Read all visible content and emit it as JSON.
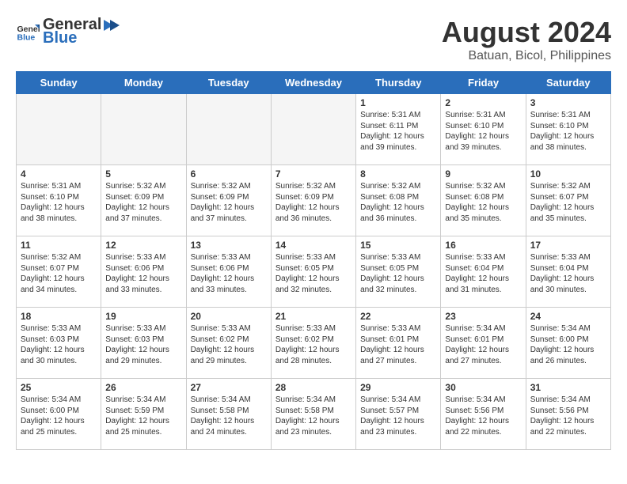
{
  "header": {
    "logo_general": "General",
    "logo_blue": "Blue",
    "month_year": "August 2024",
    "location": "Batuan, Bicol, Philippines"
  },
  "days_of_week": [
    "Sunday",
    "Monday",
    "Tuesday",
    "Wednesday",
    "Thursday",
    "Friday",
    "Saturday"
  ],
  "weeks": [
    [
      {
        "date": "",
        "text": "",
        "empty": true
      },
      {
        "date": "",
        "text": "",
        "empty": true
      },
      {
        "date": "",
        "text": "",
        "empty": true
      },
      {
        "date": "",
        "text": "",
        "empty": true
      },
      {
        "date": "1",
        "text": "Sunrise: 5:31 AM\nSunset: 6:11 PM\nDaylight: 12 hours\nand 39 minutes.",
        "empty": false
      },
      {
        "date": "2",
        "text": "Sunrise: 5:31 AM\nSunset: 6:10 PM\nDaylight: 12 hours\nand 39 minutes.",
        "empty": false
      },
      {
        "date": "3",
        "text": "Sunrise: 5:31 AM\nSunset: 6:10 PM\nDaylight: 12 hours\nand 38 minutes.",
        "empty": false
      }
    ],
    [
      {
        "date": "4",
        "text": "Sunrise: 5:31 AM\nSunset: 6:10 PM\nDaylight: 12 hours\nand 38 minutes.",
        "empty": false
      },
      {
        "date": "5",
        "text": "Sunrise: 5:32 AM\nSunset: 6:09 PM\nDaylight: 12 hours\nand 37 minutes.",
        "empty": false
      },
      {
        "date": "6",
        "text": "Sunrise: 5:32 AM\nSunset: 6:09 PM\nDaylight: 12 hours\nand 37 minutes.",
        "empty": false
      },
      {
        "date": "7",
        "text": "Sunrise: 5:32 AM\nSunset: 6:09 PM\nDaylight: 12 hours\nand 36 minutes.",
        "empty": false
      },
      {
        "date": "8",
        "text": "Sunrise: 5:32 AM\nSunset: 6:08 PM\nDaylight: 12 hours\nand 36 minutes.",
        "empty": false
      },
      {
        "date": "9",
        "text": "Sunrise: 5:32 AM\nSunset: 6:08 PM\nDaylight: 12 hours\nand 35 minutes.",
        "empty": false
      },
      {
        "date": "10",
        "text": "Sunrise: 5:32 AM\nSunset: 6:07 PM\nDaylight: 12 hours\nand 35 minutes.",
        "empty": false
      }
    ],
    [
      {
        "date": "11",
        "text": "Sunrise: 5:32 AM\nSunset: 6:07 PM\nDaylight: 12 hours\nand 34 minutes.",
        "empty": false
      },
      {
        "date": "12",
        "text": "Sunrise: 5:33 AM\nSunset: 6:06 PM\nDaylight: 12 hours\nand 33 minutes.",
        "empty": false
      },
      {
        "date": "13",
        "text": "Sunrise: 5:33 AM\nSunset: 6:06 PM\nDaylight: 12 hours\nand 33 minutes.",
        "empty": false
      },
      {
        "date": "14",
        "text": "Sunrise: 5:33 AM\nSunset: 6:05 PM\nDaylight: 12 hours\nand 32 minutes.",
        "empty": false
      },
      {
        "date": "15",
        "text": "Sunrise: 5:33 AM\nSunset: 6:05 PM\nDaylight: 12 hours\nand 32 minutes.",
        "empty": false
      },
      {
        "date": "16",
        "text": "Sunrise: 5:33 AM\nSunset: 6:04 PM\nDaylight: 12 hours\nand 31 minutes.",
        "empty": false
      },
      {
        "date": "17",
        "text": "Sunrise: 5:33 AM\nSunset: 6:04 PM\nDaylight: 12 hours\nand 30 minutes.",
        "empty": false
      }
    ],
    [
      {
        "date": "18",
        "text": "Sunrise: 5:33 AM\nSunset: 6:03 PM\nDaylight: 12 hours\nand 30 minutes.",
        "empty": false
      },
      {
        "date": "19",
        "text": "Sunrise: 5:33 AM\nSunset: 6:03 PM\nDaylight: 12 hours\nand 29 minutes.",
        "empty": false
      },
      {
        "date": "20",
        "text": "Sunrise: 5:33 AM\nSunset: 6:02 PM\nDaylight: 12 hours\nand 29 minutes.",
        "empty": false
      },
      {
        "date": "21",
        "text": "Sunrise: 5:33 AM\nSunset: 6:02 PM\nDaylight: 12 hours\nand 28 minutes.",
        "empty": false
      },
      {
        "date": "22",
        "text": "Sunrise: 5:33 AM\nSunset: 6:01 PM\nDaylight: 12 hours\nand 27 minutes.",
        "empty": false
      },
      {
        "date": "23",
        "text": "Sunrise: 5:34 AM\nSunset: 6:01 PM\nDaylight: 12 hours\nand 27 minutes.",
        "empty": false
      },
      {
        "date": "24",
        "text": "Sunrise: 5:34 AM\nSunset: 6:00 PM\nDaylight: 12 hours\nand 26 minutes.",
        "empty": false
      }
    ],
    [
      {
        "date": "25",
        "text": "Sunrise: 5:34 AM\nSunset: 6:00 PM\nDaylight: 12 hours\nand 25 minutes.",
        "empty": false
      },
      {
        "date": "26",
        "text": "Sunrise: 5:34 AM\nSunset: 5:59 PM\nDaylight: 12 hours\nand 25 minutes.",
        "empty": false
      },
      {
        "date": "27",
        "text": "Sunrise: 5:34 AM\nSunset: 5:58 PM\nDaylight: 12 hours\nand 24 minutes.",
        "empty": false
      },
      {
        "date": "28",
        "text": "Sunrise: 5:34 AM\nSunset: 5:58 PM\nDaylight: 12 hours\nand 23 minutes.",
        "empty": false
      },
      {
        "date": "29",
        "text": "Sunrise: 5:34 AM\nSunset: 5:57 PM\nDaylight: 12 hours\nand 23 minutes.",
        "empty": false
      },
      {
        "date": "30",
        "text": "Sunrise: 5:34 AM\nSunset: 5:56 PM\nDaylight: 12 hours\nand 22 minutes.",
        "empty": false
      },
      {
        "date": "31",
        "text": "Sunrise: 5:34 AM\nSunset: 5:56 PM\nDaylight: 12 hours\nand 22 minutes.",
        "empty": false
      }
    ]
  ]
}
